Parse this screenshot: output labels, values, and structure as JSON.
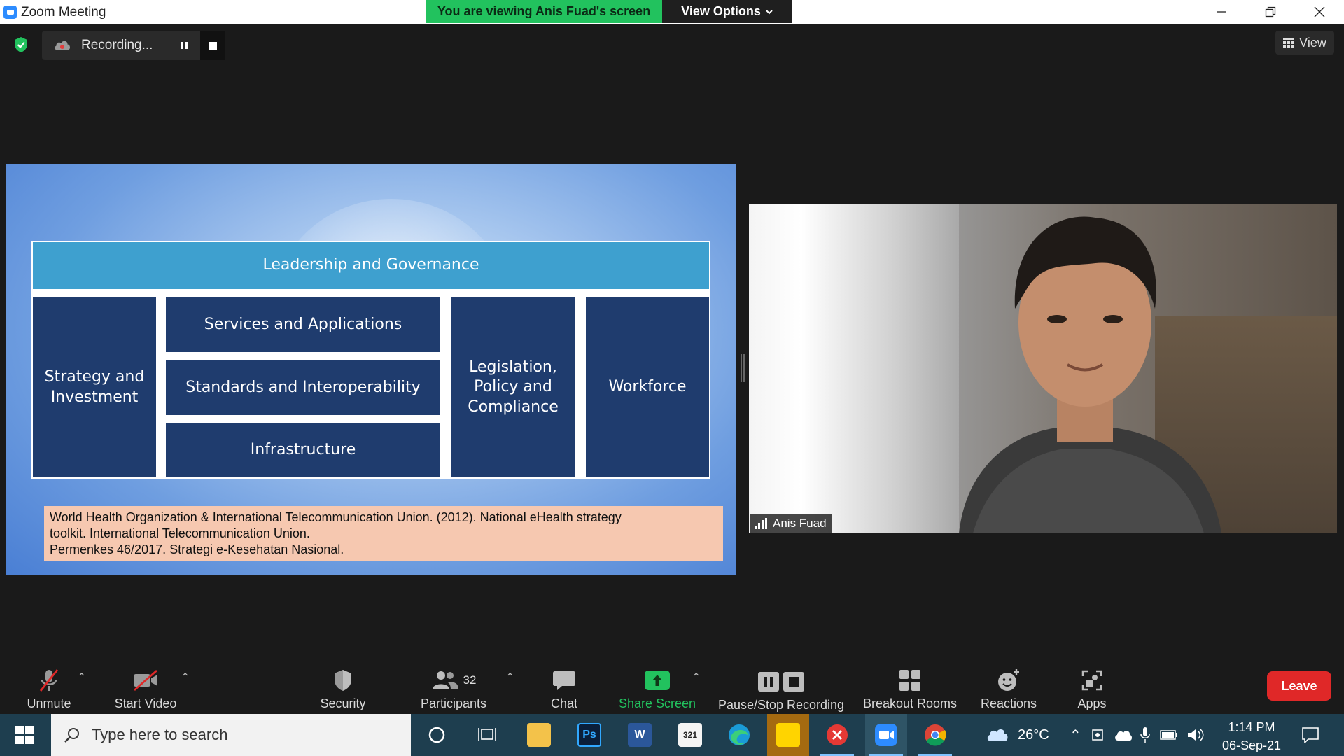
{
  "window": {
    "title": "Zoom Meeting"
  },
  "banner": {
    "viewing": "You are viewing Anis Fuad's screen",
    "view_options": "View Options"
  },
  "recording": {
    "status": "Recording..."
  },
  "view_button": {
    "label": "View"
  },
  "slide": {
    "top_box": "Leadership and Governance",
    "boxes": {
      "strategy": "Strategy and Investment",
      "services": "Services and Applications",
      "standards": "Standards and Interoperability",
      "infrastructure": "Infrastructure",
      "legislation": "Legislation, Policy and Compliance",
      "workforce": "Workforce"
    },
    "citation_line1": "World Health Organization & International Telecommunication Union. (2012). National eHealth strategy",
    "citation_line2": "toolkit. International Telecommunication Union.",
    "citation_line3": "Permenkes 46/2017. Strategi e-Kesehatan Nasional."
  },
  "video": {
    "name": "Anis Fuad"
  },
  "toolbar": {
    "unmute": "Unmute",
    "start_video": "Start Video",
    "security": "Security",
    "participants": "Participants",
    "participants_count": "32",
    "chat": "Chat",
    "share_screen": "Share Screen",
    "pause_stop": "Pause/Stop Recording",
    "breakout": "Breakout Rooms",
    "reactions": "Reactions",
    "apps": "Apps",
    "leave": "Leave"
  },
  "taskbar": {
    "search_placeholder": "Type here to search",
    "temperature": "26°C",
    "time": "1:14 PM",
    "date": "06-Sep-21"
  },
  "colors": {
    "zoom_blue": "#2d8cff",
    "share_green": "#22c25e",
    "leave_red": "#e02828",
    "slide_box": "#1f3c6e",
    "slide_top": "#3ea0cf"
  }
}
